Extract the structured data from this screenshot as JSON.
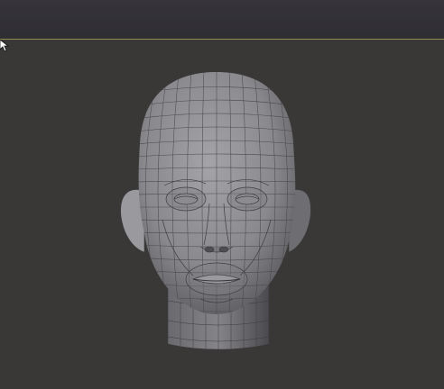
{
  "app": {
    "background_color": "#3a3836",
    "viewport_border_color": "#8f8a4e"
  },
  "viewport": {
    "model": {
      "subject": "head-mesh",
      "shading": "grey-clay",
      "wireframe_overlay": true,
      "mesh_color": "#4a4a4e"
    },
    "cursor": {
      "icon": "mouse-pointer-icon"
    }
  }
}
